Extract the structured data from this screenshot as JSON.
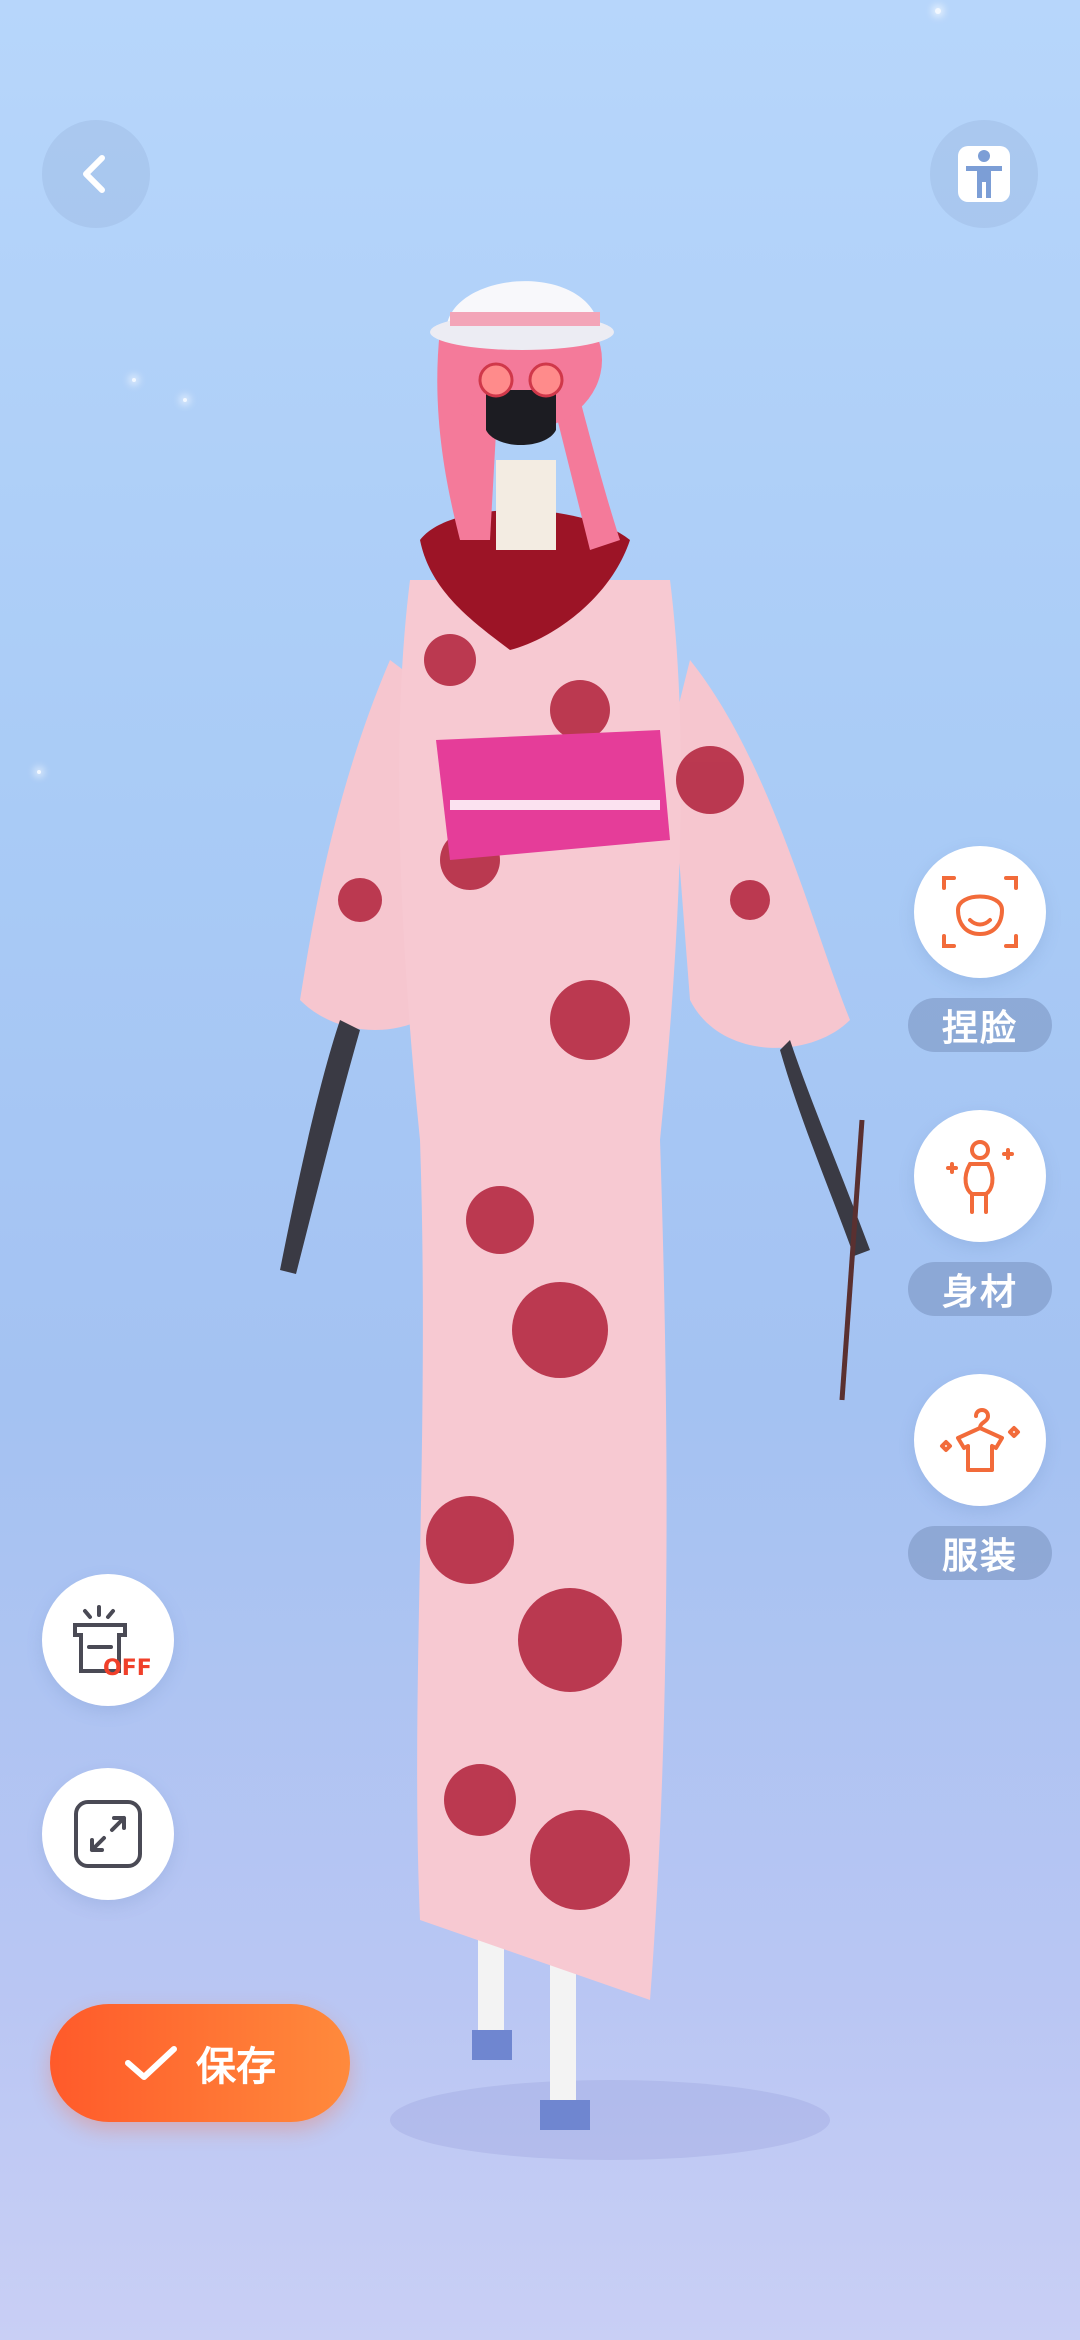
{
  "colors": {
    "accent": "#ff6a35",
    "icon_orange": "#f26b3a",
    "label_bg": "#7891be"
  },
  "top_bar": {
    "back_icon": "chevron-left-icon",
    "pose_icon": "standing-person-icon"
  },
  "side_menu": [
    {
      "icon": "face-icon",
      "label": "捏脸"
    },
    {
      "icon": "body-icon",
      "label": "身材"
    },
    {
      "icon": "clothes-hanger-icon",
      "label": "服装"
    }
  ],
  "left_tools": {
    "light_toggle_badge": "OFF",
    "light_toggle_icon": "lamp-off-icon",
    "fullscreen_icon": "expand-icon"
  },
  "save_button": {
    "label": "保存",
    "icon": "checkmark-icon"
  }
}
